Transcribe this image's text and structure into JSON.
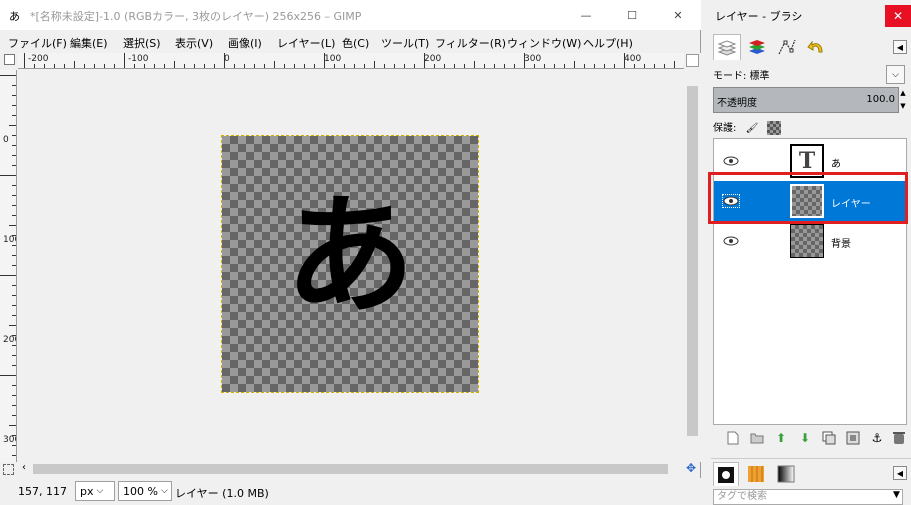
{
  "window": {
    "app_icon": "あ",
    "title": "*[名称未設定]-1.0 (RGBカラー, 3枚のレイヤー) 256x256 – GIMP",
    "minimize": "—",
    "maximize": "☐",
    "close": "✕"
  },
  "menu": [
    "ファイル(F)",
    "編集(E)",
    "選択(S)",
    "表示(V)",
    "画像(I)",
    "レイヤー(L)",
    "色(C)",
    "ツール(T)",
    "フィルター(R)",
    "ウィンドウ(W)",
    "ヘルプ(H)"
  ],
  "ruler": {
    "h_labels": [
      "-200",
      "-100",
      "0",
      "100",
      "200",
      "300",
      "400"
    ],
    "v_labels": [
      "0",
      "100",
      "200",
      "300"
    ]
  },
  "canvas": {
    "glyph": "あ"
  },
  "status": {
    "coords": "157, 117",
    "unit": "px",
    "zoom": "100 %",
    "info": "レイヤー (1.0 MB)"
  },
  "dock": {
    "title": "レイヤー - ブラシ",
    "close": "✕",
    "mode_label": "モード: 標準",
    "opacity_label": "不透明度",
    "opacity_value": "100.0",
    "lock_label": "保護:",
    "layers": [
      {
        "name": "あ",
        "type": "text",
        "selected": false
      },
      {
        "name": "レイヤー",
        "type": "raster",
        "selected": true
      },
      {
        "name": "背景",
        "type": "raster",
        "selected": false
      }
    ],
    "tag_placeholder": "タグで検索"
  }
}
